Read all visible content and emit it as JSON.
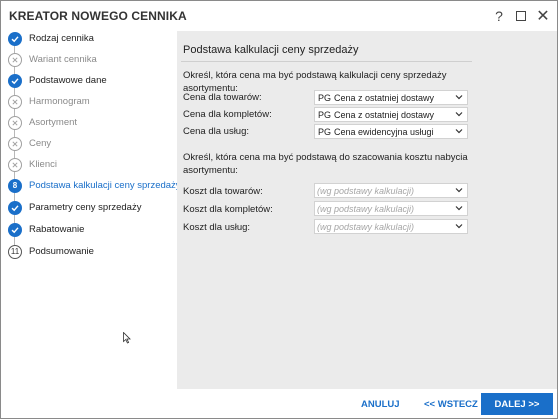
{
  "window": {
    "title": "KREATOR NOWEGO CENNIKA",
    "help_glyph": "?",
    "close_glyph": "✕"
  },
  "steps": [
    {
      "label": "Rodzaj cennika",
      "state": "done"
    },
    {
      "label": "Wariant cennika",
      "state": "skip"
    },
    {
      "label": "Podstawowe dane",
      "state": "done"
    },
    {
      "label": "Harmonogram",
      "state": "skip"
    },
    {
      "label": "Asortyment",
      "state": "skip"
    },
    {
      "label": "Ceny",
      "state": "skip"
    },
    {
      "label": "Klienci",
      "state": "skip"
    },
    {
      "label": "Podstawa kalkulacji ceny sprzedaży",
      "state": "active",
      "number": "8"
    },
    {
      "label": "Parametry ceny sprzedaży",
      "state": "done"
    },
    {
      "label": "Rabatowanie",
      "state": "done"
    },
    {
      "label": "Podsumowanie",
      "state": "todo",
      "number": "11"
    }
  ],
  "main": {
    "section_title": "Podstawa kalkulacji ceny sprzedaży",
    "sales_desc": "Określ, która cena ma być podstawą kalkulacji ceny sprzedaży asortymentu:",
    "sales_rows": [
      {
        "label": "Cena dla towarów:",
        "code": "PG",
        "value": "Cena z ostatniej dostawy"
      },
      {
        "label": "Cena dla kompletów:",
        "code": "PG",
        "value": "Cena z ostatniej dostawy"
      },
      {
        "label": "Cena dla usług:",
        "code": "PG",
        "value": "Cena ewidencyjna usługi"
      }
    ],
    "cost_desc": "Określ, która cena ma być podstawą do szacowania kosztu nabycia asortymentu:",
    "cost_rows": [
      {
        "label": "Koszt dla towarów:",
        "placeholder": "(wg podstawy kalkulacji)"
      },
      {
        "label": "Koszt dla kompletów:",
        "placeholder": "(wg podstawy kalkulacji)"
      },
      {
        "label": "Koszt dla usług:",
        "placeholder": "(wg podstawy kalkulacji)"
      }
    ]
  },
  "footer": {
    "cancel": "ANULUJ",
    "back": "<< WSTECZ",
    "next": "DALEJ >>"
  },
  "colors": {
    "accent": "#1a6fc9",
    "panel_bg": "#ebebeb"
  }
}
